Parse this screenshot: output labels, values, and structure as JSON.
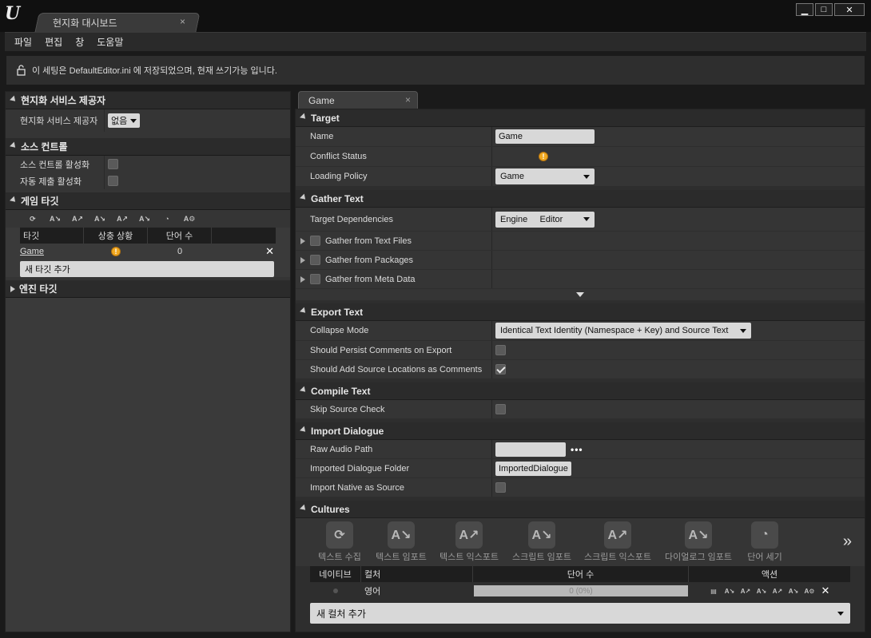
{
  "window": {
    "tab_title": "현지화 대시보드",
    "tab_close": "×",
    "minimize": "▁",
    "maximize": "□",
    "close": "✕"
  },
  "menu": [
    "파일",
    "편집",
    "창",
    "도움말"
  ],
  "info": {
    "text": "이 세팅은 DefaultEditor.ini 에 저장되었으며, 현재 쓰기가능 입니다."
  },
  "left": {
    "provider_section": {
      "title": "현지화 서비스 제공자",
      "prop_label": "현지화 서비스 제공자",
      "value": "없음"
    },
    "source_control": {
      "title": "소스 컨트롤",
      "enable_label": "소스 컨트롤 활성화",
      "auto_submit_label": "자동 제출 활성화"
    },
    "game_targets": {
      "title": "게임 타깃",
      "columns": [
        "타깃",
        "상충 상황",
        "단어 수"
      ],
      "rows": [
        {
          "name": "Game",
          "conflict": "!",
          "words": "0"
        }
      ],
      "add_button": "새 타깃 추가"
    },
    "engine_targets": {
      "title": "엔진 타깃"
    }
  },
  "right": {
    "tab_label": "Game",
    "tab_close": "×",
    "target": {
      "title": "Target",
      "name_label": "Name",
      "name_value": "Game",
      "conflict_label": "Conflict Status",
      "loading_label": "Loading Policy",
      "loading_value": "Game"
    },
    "gather": {
      "title": "Gather Text",
      "deps_label": "Target Dependencies",
      "deps_value_a": "Engine",
      "deps_value_b": "Editor",
      "text_files": "Gather from Text Files",
      "packages": "Gather from Packages",
      "meta": "Gather from Meta Data"
    },
    "export": {
      "title": "Export Text",
      "collapse_label": "Collapse Mode",
      "collapse_value": "Identical Text Identity (Namespace + Key) and Source Text",
      "persist_label": "Should Persist Comments on Export",
      "add_source_label": "Should Add Source Locations as Comments"
    },
    "compile": {
      "title": "Compile Text",
      "skip_label": "Skip Source Check"
    },
    "import_dialogue": {
      "title": "Import Dialogue",
      "raw_audio_label": "Raw Audio Path",
      "raw_audio_value": "",
      "dots": "•••",
      "folder_label": "Imported Dialogue Folder",
      "folder_value": "ImportedDialogue",
      "native_label": "Import Native as Source"
    },
    "cultures": {
      "title": "Cultures",
      "tools": [
        "텍스트 수집",
        "텍스트 임포트",
        "텍스트 익스포트",
        "스크립트 임포트",
        "스크립트 익스포트",
        "다이얼로그 임포트",
        "단어 세기"
      ],
      "columns": [
        "네이티브",
        "컬처",
        "단어 수",
        "액션"
      ],
      "rows": [
        {
          "culture": "영어",
          "word_count": "0 (0%)"
        }
      ],
      "add_button": "새 컬처 추가"
    }
  }
}
